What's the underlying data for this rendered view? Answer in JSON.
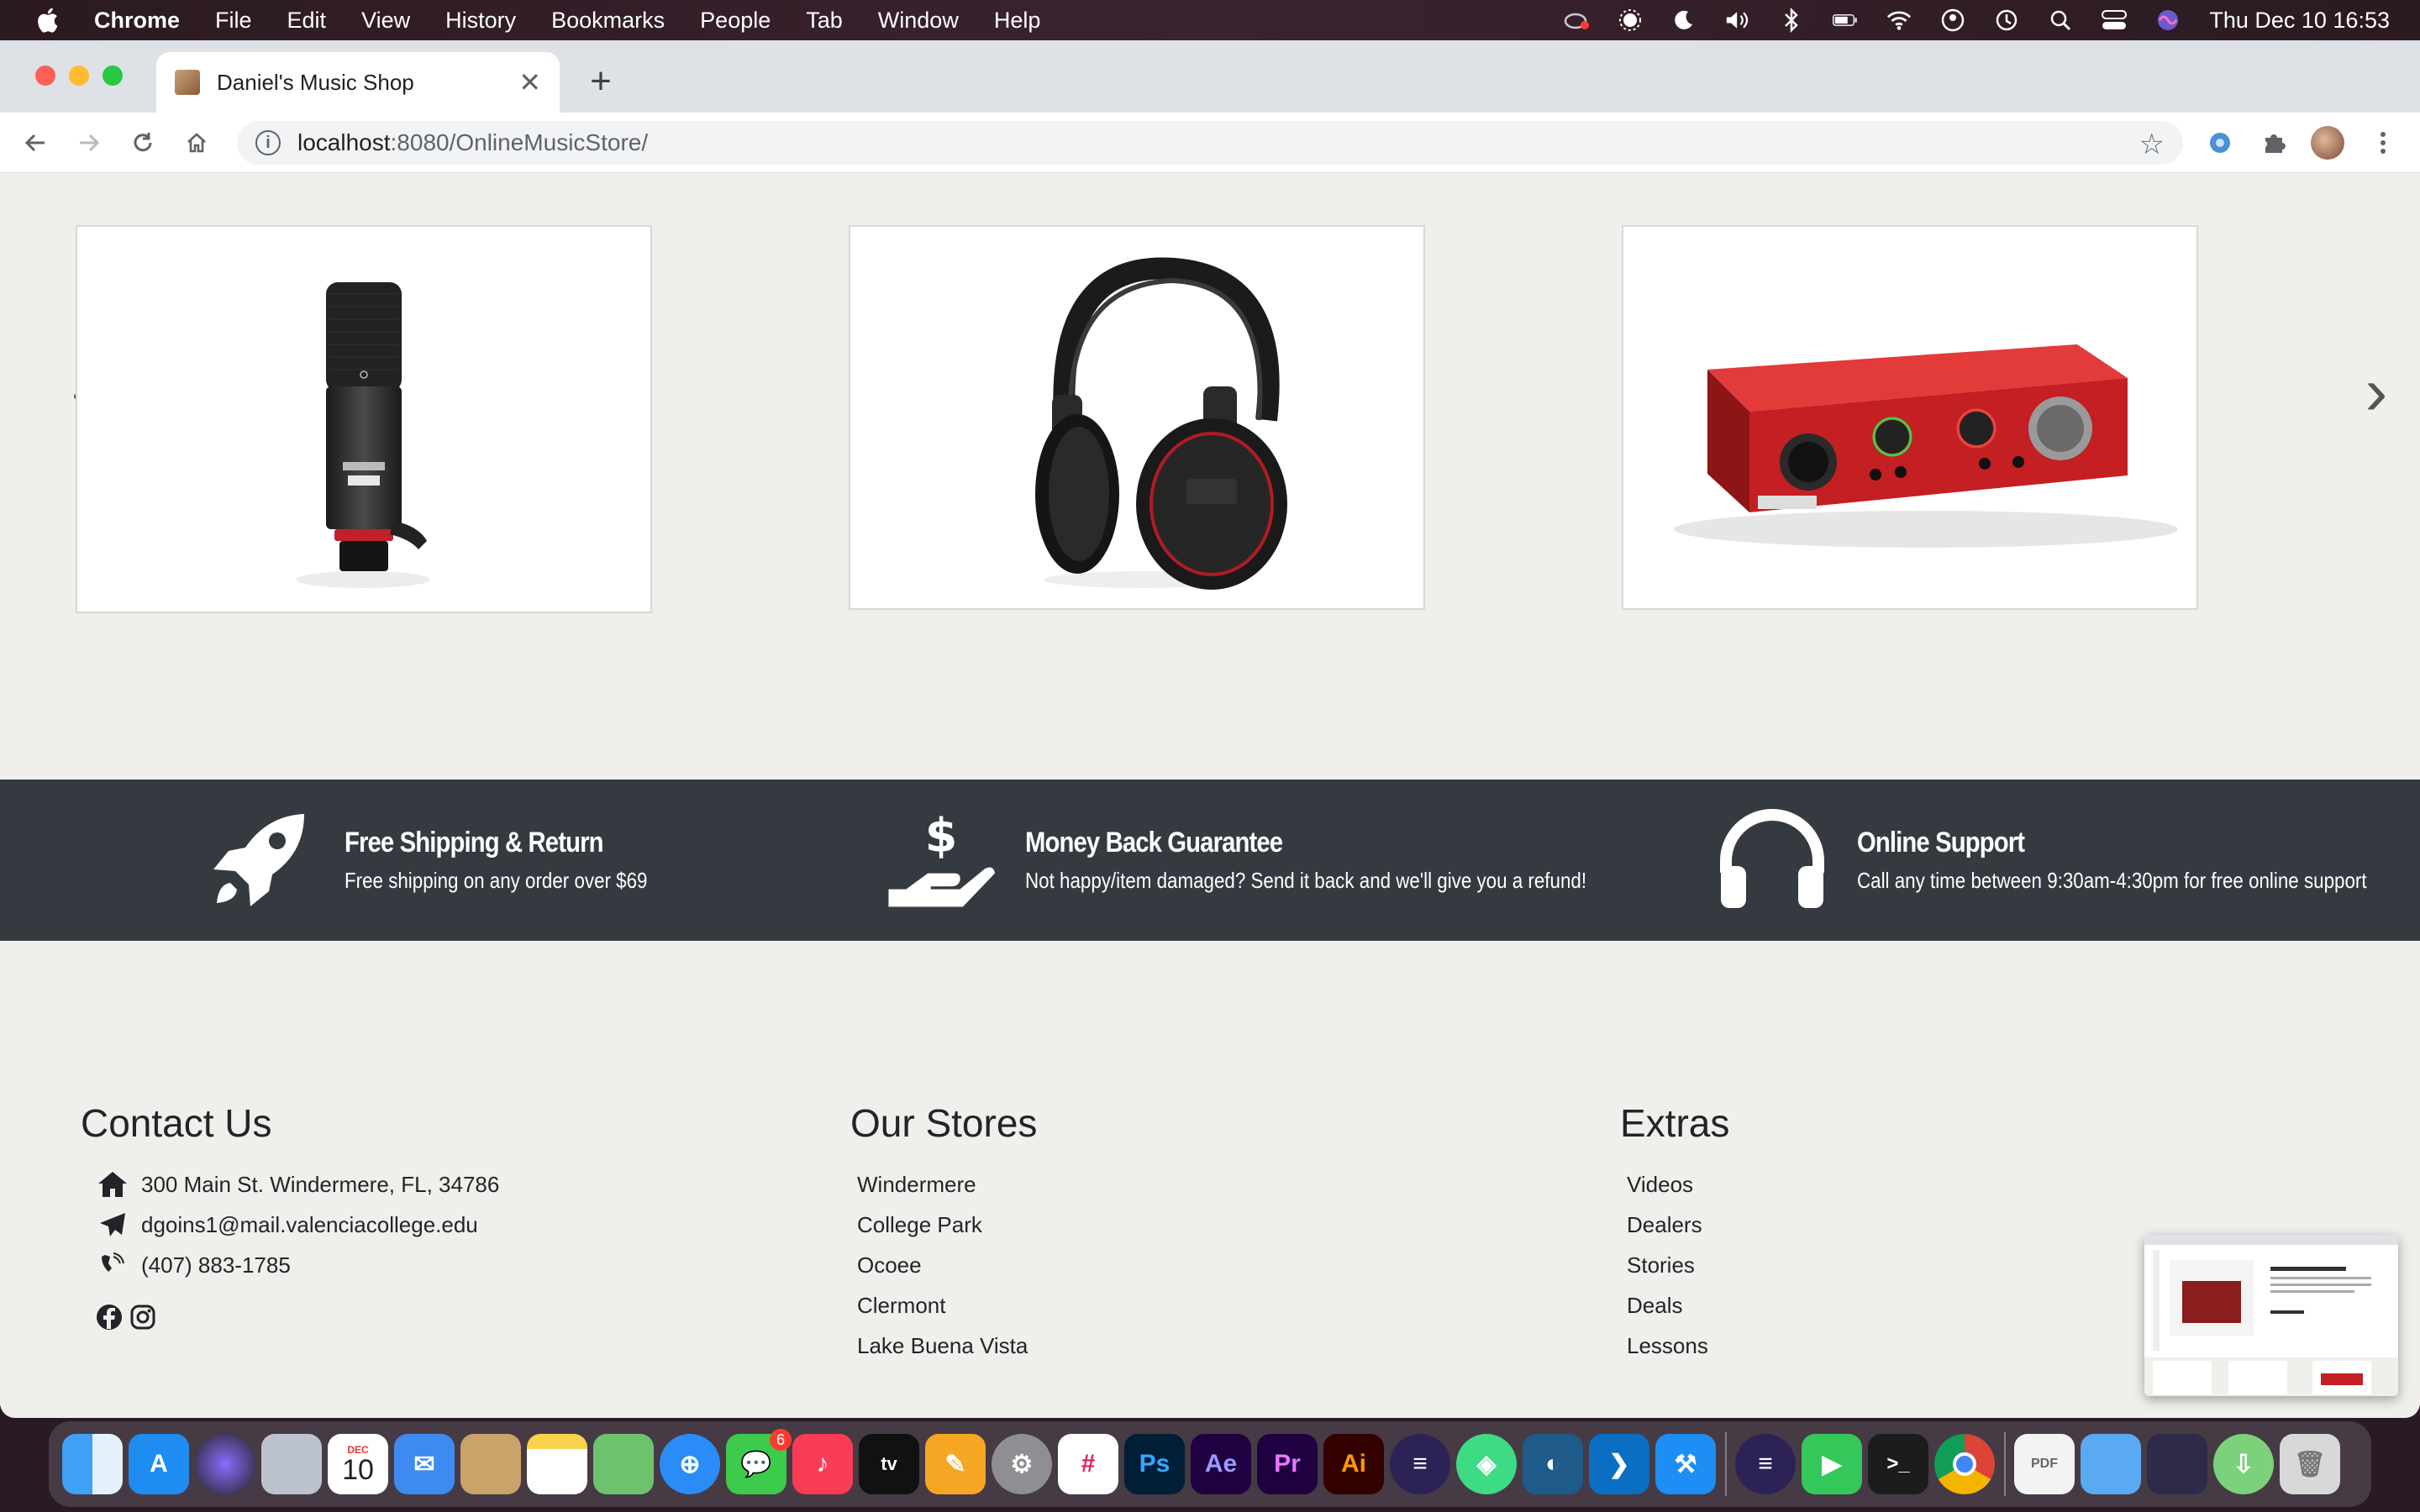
{
  "menubar": {
    "items": [
      "Chrome",
      "File",
      "Edit",
      "View",
      "History",
      "Bookmarks",
      "People",
      "Tab",
      "Window",
      "Help"
    ],
    "clock": "Thu Dec 10  16:53"
  },
  "browser": {
    "tab_title": "Daniel's Music Shop",
    "url_host": "localhost",
    "url_path": ":8080/OnlineMusicStore/"
  },
  "carousel": {
    "products": [
      "microphone",
      "headphones",
      "audio-interface"
    ]
  },
  "features": [
    {
      "title": "Free Shipping & Return",
      "desc": "Free shipping on any order over $69",
      "icon": "rocket-icon"
    },
    {
      "title": "Money Back Guarantee",
      "desc": "Not happy/item damaged? Send it back and we'll give you a refund!",
      "icon": "money-hand-icon"
    },
    {
      "title": "Online Support",
      "desc": "Call any time between 9:30am-4:30pm for free online support",
      "icon": "headphones-icon"
    }
  ],
  "footer": {
    "contact": {
      "heading": "Contact Us",
      "address": "300 Main St. Windermere, FL, 34786",
      "email": "dgoins1@mail.valenciacollege.edu",
      "phone": "(407) 883-1785"
    },
    "stores": {
      "heading": "Our Stores",
      "items": [
        "Windermere",
        "College Park",
        "Ocoee",
        "Clermont",
        "Lake Buena Vista"
      ]
    },
    "extras": {
      "heading": "Extras",
      "items": [
        "Videos",
        "Dealers",
        "Stories",
        "Deals",
        "Lessons"
      ]
    }
  },
  "dock": {
    "calendar_month": "DEC",
    "calendar_day": "10",
    "messages_badge": "6",
    "apps": [
      "Finder",
      "App Store",
      "Siri",
      "Launchpad",
      "Calendar",
      "Mail",
      "Contacts",
      "Notes",
      "Maps",
      "Safari",
      "Messages",
      "Music",
      "TV",
      "Pages",
      "System Preferences",
      "Slack",
      "Photoshop",
      "After Effects",
      "Premiere Pro",
      "Illustrator",
      "Eclipse",
      "Android Studio",
      "MySQL Workbench",
      "VS Code",
      "Xcode",
      "Eclipse 2",
      "FaceTime",
      "Terminal",
      "Chrome",
      "Preview",
      "Folder",
      "Screenshot",
      "Transmit",
      "Trash"
    ]
  }
}
